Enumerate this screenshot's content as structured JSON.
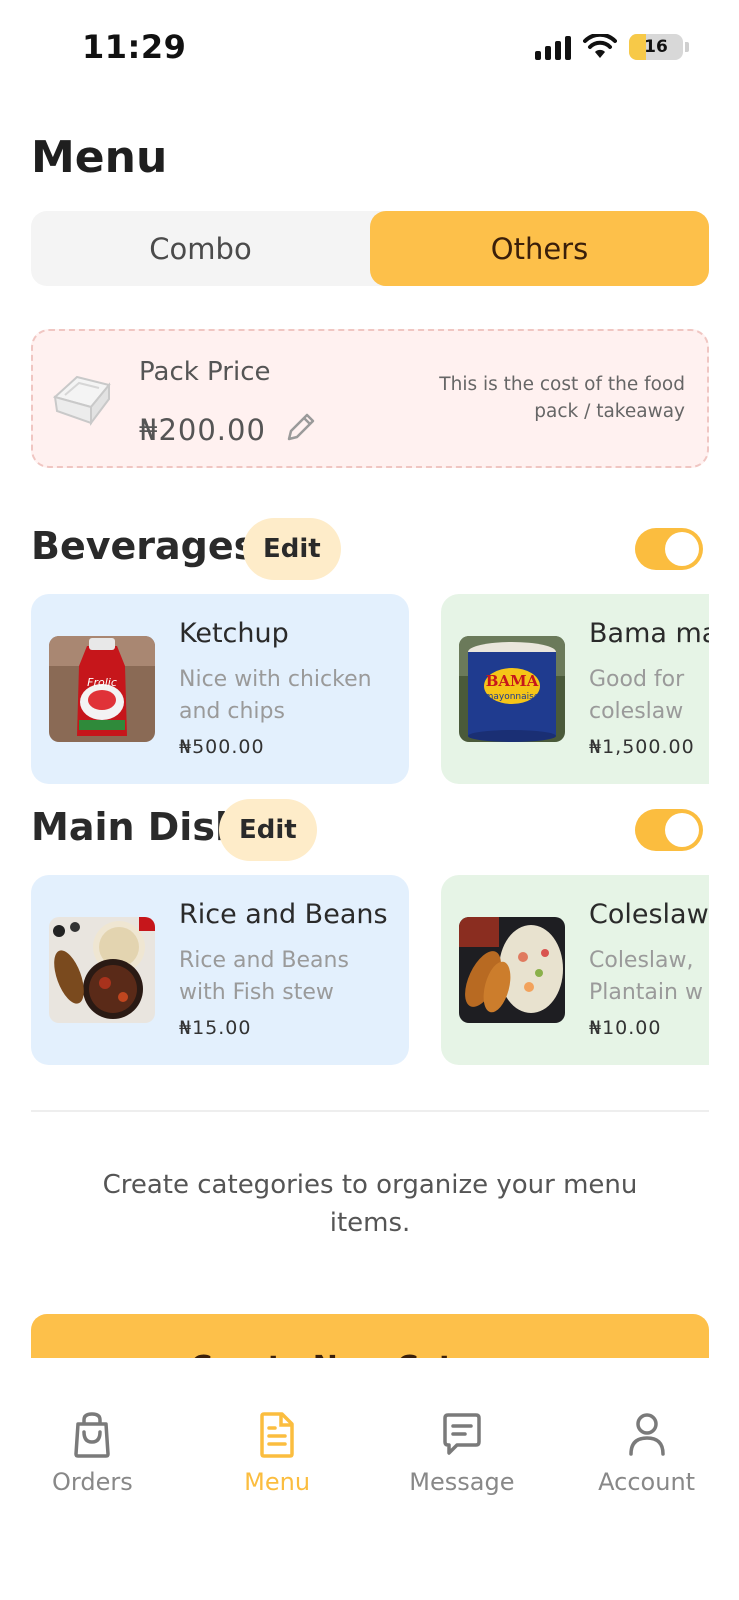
{
  "status_bar": {
    "time": "11:29",
    "battery": "16"
  },
  "page": {
    "title": "Menu"
  },
  "tabs": [
    {
      "label": "Combo",
      "active": false
    },
    {
      "label": "Others",
      "active": true
    }
  ],
  "pack": {
    "title": "Pack Price",
    "price": "₦200.00",
    "note": "This is the cost of the food pack / takeaway"
  },
  "sections": [
    {
      "title": "Beverages",
      "edit_label": "Edit",
      "enabled": true,
      "items": [
        {
          "name": "Ketchup",
          "desc_line1": "Nice with chicken",
          "desc_line2": "and chips",
          "price": "₦500.00"
        },
        {
          "name": "Bama ma",
          "desc_line1": "Good for",
          "desc_line2": "coleslaw",
          "price": "₦1,500.00"
        }
      ]
    },
    {
      "title": "Main Dish",
      "edit_label": "Edit",
      "enabled": true,
      "items": [
        {
          "name": "Rice and Beans",
          "desc_line1": "Rice and Beans",
          "desc_line2": "with Fish stew",
          "price": "₦15.00"
        },
        {
          "name": "Coleslaw",
          "desc_line1": "Coleslaw,",
          "desc_line2": "Plantain w",
          "price": "₦10.00"
        }
      ]
    }
  ],
  "help_text": "Create categories to organize your menu items.",
  "create_button_label": "Create New Category",
  "nav": [
    {
      "label": "Orders",
      "icon": "shopping-bag-icon",
      "active": false
    },
    {
      "label": "Menu",
      "icon": "document-icon",
      "active": true
    },
    {
      "label": "Message",
      "icon": "chat-icon",
      "active": false
    },
    {
      "label": "Account",
      "icon": "user-icon",
      "active": false
    }
  ],
  "colors": {
    "accent": "#fdc04a",
    "pack_bg": "#fff1f0",
    "card_blue": "#e3f0fd",
    "card_green": "#e6f4e6"
  }
}
